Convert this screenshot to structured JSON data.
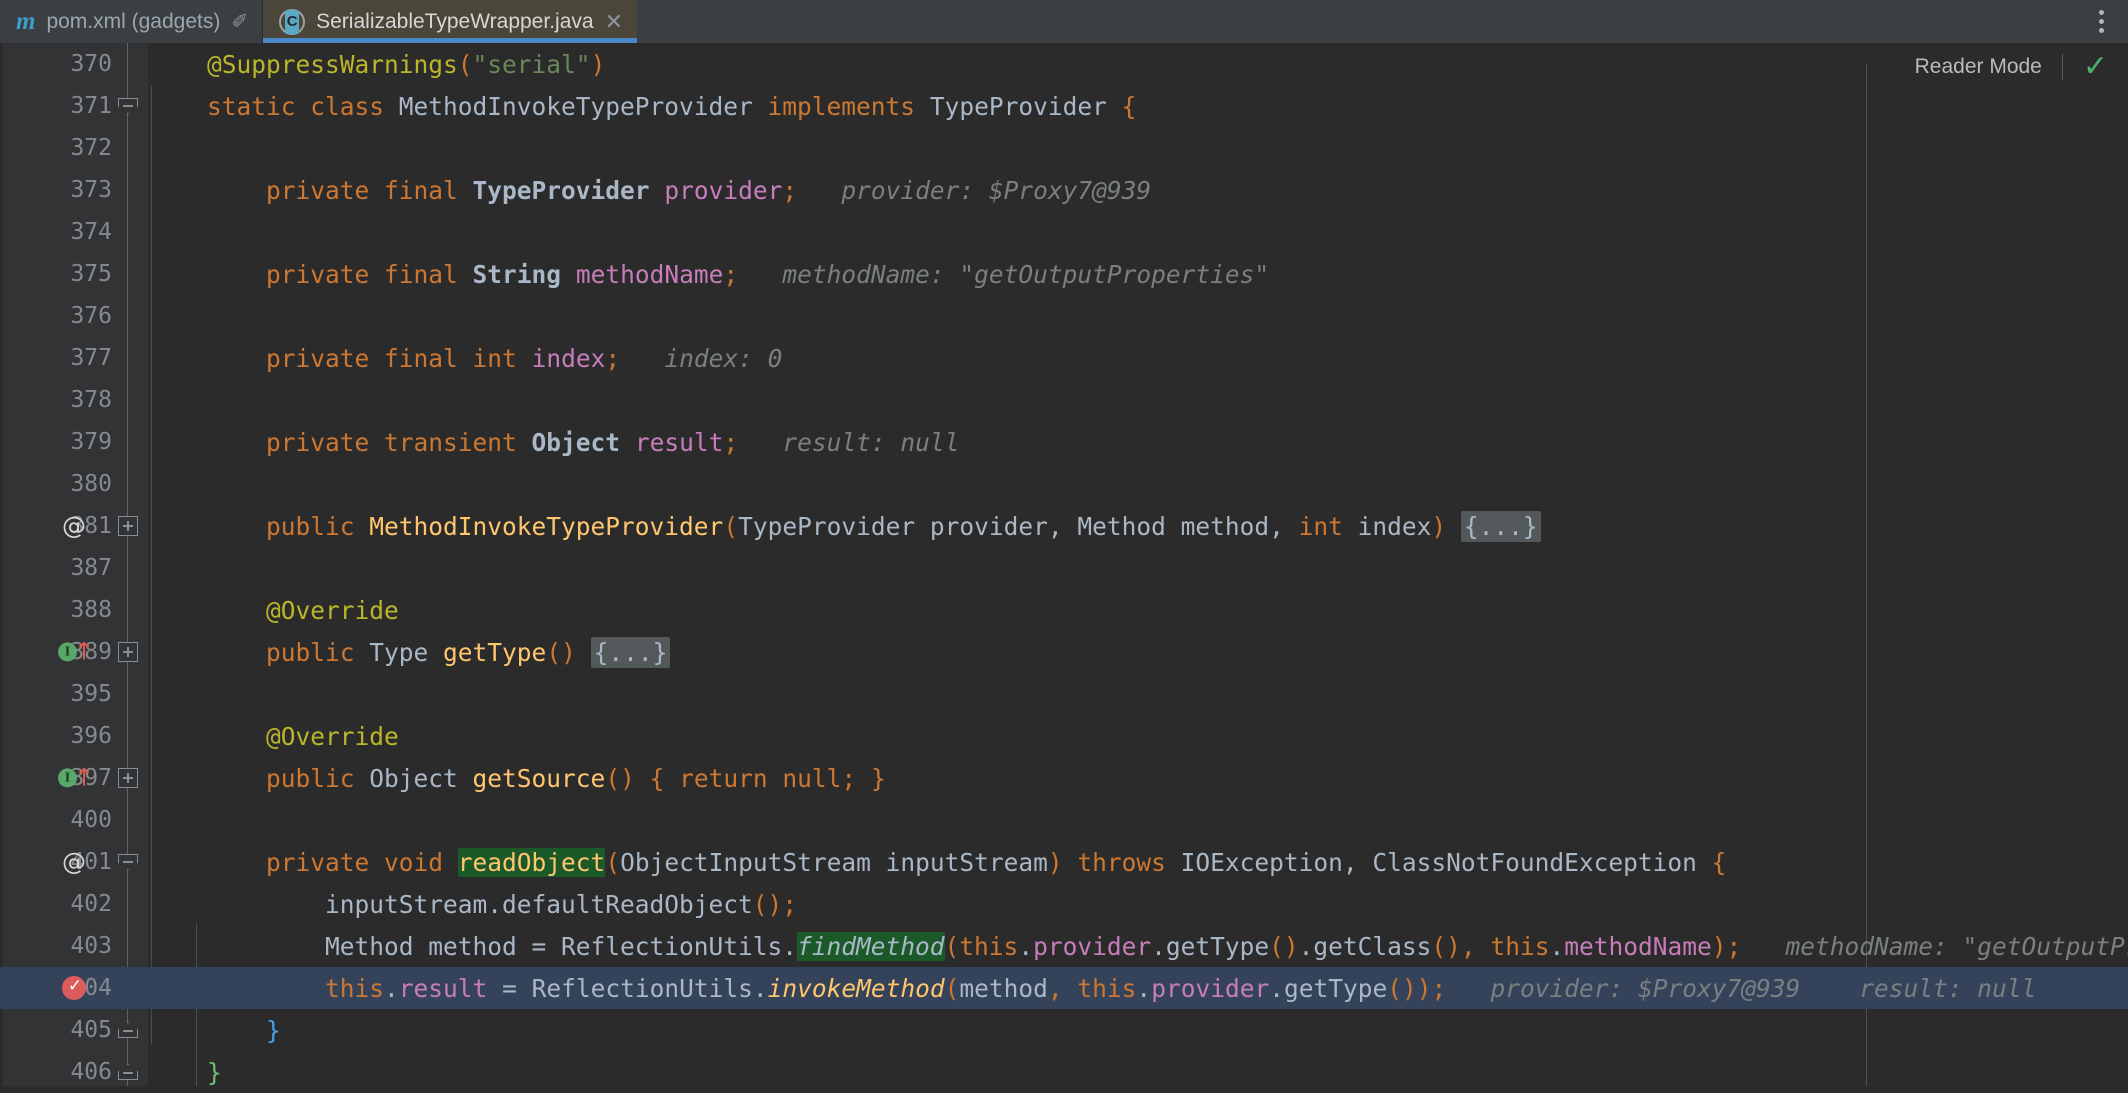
{
  "tabs": [
    {
      "label": "pom.xml (gadgets)",
      "icon": "maven-icon",
      "active": false,
      "pinned": true,
      "pin_glyph": "✐"
    },
    {
      "label": "SerializableTypeWrapper.java",
      "icon": "java-class-icon",
      "icon_letter": "C",
      "active": true,
      "close_glyph": "✕"
    }
  ],
  "toolbar": {
    "kebab_name": "more-options-icon"
  },
  "editor": {
    "reader_mode_label": "Reader Mode",
    "reader_mode_check": "✓",
    "colors": {
      "background": "#2b2b2b",
      "gutter": "#313335",
      "tab_active": "#4a4639",
      "tab_underline": "#4a88c7",
      "line_highlight": "#34425a",
      "keyword": "#cc7832",
      "annotation": "#bbb529",
      "string": "#6a8759",
      "field": "#c77dbb",
      "method": "#ffc66d",
      "inline_hint": "#7a7f82",
      "usage_highlight": "#1b5a28",
      "breakpoint": "#db5c5c",
      "implementing": "#59a869"
    },
    "lines": [
      {
        "n": "370",
        "gutter": null,
        "fold": null
      },
      {
        "n": "371",
        "gutter": null,
        "fold": "minus-top"
      },
      {
        "n": "372",
        "gutter": null,
        "fold": null
      },
      {
        "n": "373",
        "gutter": null,
        "fold": null
      },
      {
        "n": "374",
        "gutter": null,
        "fold": null
      },
      {
        "n": "375",
        "gutter": null,
        "fold": null
      },
      {
        "n": "376",
        "gutter": null,
        "fold": null
      },
      {
        "n": "377",
        "gutter": null,
        "fold": null
      },
      {
        "n": "378",
        "gutter": null,
        "fold": null
      },
      {
        "n": "379",
        "gutter": null,
        "fold": null
      },
      {
        "n": "380",
        "gutter": null,
        "fold": null
      },
      {
        "n": "381",
        "gutter": "at",
        "fold": "plus"
      },
      {
        "n": "387",
        "gutter": null,
        "fold": null
      },
      {
        "n": "388",
        "gutter": null,
        "fold": null
      },
      {
        "n": "389",
        "gutter": "implementing",
        "fold": "plus"
      },
      {
        "n": "395",
        "gutter": null,
        "fold": null
      },
      {
        "n": "396",
        "gutter": null,
        "fold": null
      },
      {
        "n": "397",
        "gutter": "implementing",
        "fold": "plus"
      },
      {
        "n": "400",
        "gutter": null,
        "fold": null
      },
      {
        "n": "401",
        "gutter": "at",
        "fold": "minus-top"
      },
      {
        "n": "402",
        "gutter": null,
        "fold": null
      },
      {
        "n": "403",
        "gutter": null,
        "fold": null
      },
      {
        "n": "404",
        "gutter": "breakpoint",
        "fold": null,
        "highlight": true
      },
      {
        "n": "405",
        "gutter": null,
        "fold": "minus-bot"
      },
      {
        "n": "406",
        "gutter": null,
        "fold": "minus-bot"
      }
    ],
    "code": {
      "l370": "@SuppressWarnings(\"serial\")",
      "l371": "static class MethodInvokeTypeProvider implements TypeProvider {",
      "l373": "private final TypeProvider provider;",
      "l373_hint": "provider: $Proxy7@939",
      "l375": "private final String methodName;",
      "l375_hint": "methodName: \"getOutputProperties\"",
      "l377": "private final int index;",
      "l377_hint": "index: 0",
      "l379": "private transient Object result;",
      "l379_hint": "result: null",
      "l381": "public MethodInvokeTypeProvider(TypeProvider provider, Method method, int index) {...}",
      "l388": "@Override",
      "l389": "public Type getType() {...}",
      "l396": "@Override",
      "l397": "public Object getSource() { return null; }",
      "l401": "private void readObject(ObjectInputStream inputStream) throws IOException, ClassNotFoundException {",
      "l402": "inputStream.defaultReadObject();",
      "l403": "Method method = ReflectionUtils.findMethod(this.provider.getType().getClass(), this.methodName);",
      "l403_hint": "methodName: \"getOutputProper",
      "l404": "this.result = ReflectionUtils.invokeMethod(method, this.provider.getType());",
      "l404_hint_a": "provider: $Proxy7@939",
      "l404_hint_b": "result: null",
      "l405": "}",
      "l406": "}",
      "fold_placeholder": "{...}",
      "highlighted_symbol_401": "readObject",
      "highlighted_symbol_403": "findMethod"
    }
  }
}
